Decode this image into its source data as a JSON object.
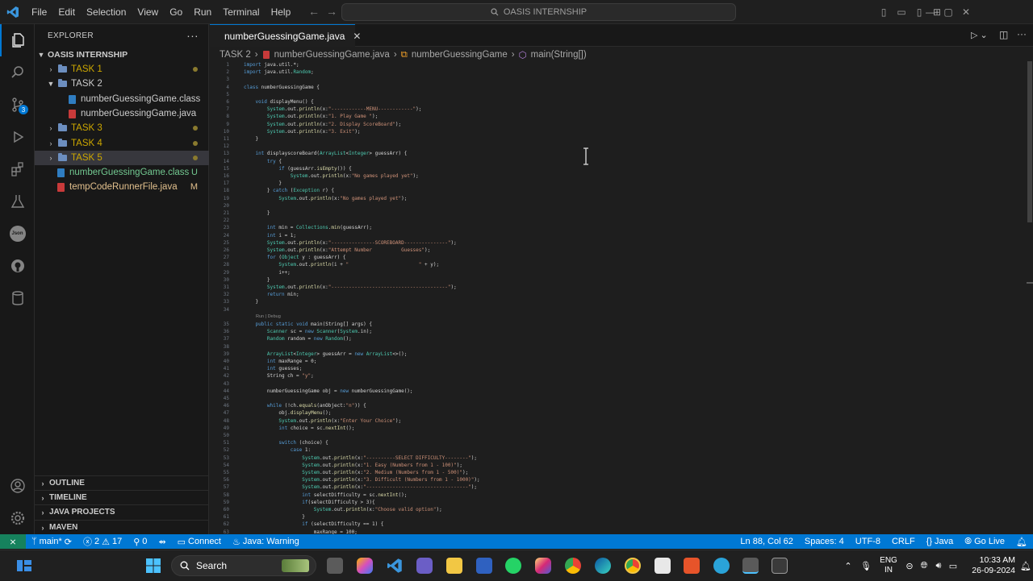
{
  "titlebar": {
    "menus": [
      "File",
      "Edit",
      "Selection",
      "View",
      "Go",
      "Run",
      "Terminal",
      "Help"
    ],
    "search_text": "OASIS INTERNSHIP"
  },
  "sidebar": {
    "header": "EXPLORER",
    "root": "OASIS INTERNSHIP",
    "items": [
      {
        "label": "TASK 1",
        "kind": "folder",
        "mark": "dot"
      },
      {
        "label": "TASK 2",
        "kind": "folder-open",
        "mark": ""
      },
      {
        "label": "numberGuessingGame.class",
        "kind": "class",
        "mark": ""
      },
      {
        "label": "numberGuessingGame.java",
        "kind": "java",
        "mark": ""
      },
      {
        "label": "TASK 3",
        "kind": "folder",
        "mark": "dot"
      },
      {
        "label": "TASK 4",
        "kind": "folder",
        "mark": "dot"
      },
      {
        "label": "TASK 5",
        "kind": "folder",
        "mark": "dot"
      },
      {
        "label": "numberGuessingGame.class",
        "kind": "class",
        "mark": "U"
      },
      {
        "label": "tempCodeRunnerFile.java",
        "kind": "java",
        "mark": "M"
      }
    ],
    "panels": [
      "OUTLINE",
      "TIMELINE",
      "JAVA PROJECTS",
      "MAVEN"
    ]
  },
  "editor": {
    "tab": "numberGuessingGame.java",
    "breadcrumb": [
      "TASK 2",
      "numberGuessingGame.java",
      "numberGuessingGame",
      "main(String[])"
    ],
    "codelens": "Run | Debug",
    "lines": [
      "import java.util.*;",
      "import java.util.Random;",
      "",
      "class numberGuessingGame {",
      "",
      "    void displayMenu() {",
      "        System.out.println(x:\"------------MENU------------\");",
      "        System.out.println(x:\"1. Play Game \");",
      "        System.out.println(x:\"2. Display ScoreBoard\");",
      "        System.out.println(x:\"3. Exit\");",
      "    }",
      "",
      "    int displayscoreBoard(ArrayList<Integer> guessArr) {",
      "        try {",
      "            if (guessArr.isEmpty()) {",
      "                System.out.println(x:\"No games played yet\");",
      "            }",
      "        } catch (Exception r) {",
      "            System.out.println(x:\"No games played yet\");",
      "",
      "        }",
      "",
      "        int min = Collections.min(guessArr);",
      "        int i = 1;",
      "        System.out.println(x:\"---------------SCOREBOARD---------------\");",
      "        System.out.println(x:\"Attempt Number          Guesses\");",
      "        for (Object y : guessArr) {",
      "            System.out.println(i + \"                        \" + y);",
      "            i++;",
      "        }",
      "        System.out.println(x:\"----------------------------------------\");",
      "        return min;",
      "    }",
      "",
      "    public static void main(String[] args) {",
      "        Scanner sc = new Scanner(System.in);",
      "        Random random = new Random();",
      "",
      "        ArrayList<Integer> guessArr = new ArrayList<>();",
      "        int maxRange = 0;",
      "        int guesses;",
      "        String ch = \"y\";",
      "",
      "        numberGuessingGame obj = new numberGuessingGame();",
      "",
      "        while (!ch.equals(anObject:\"n\")) {",
      "            obj.displayMenu();",
      "            System.out.println(x:\"Enter Your Choice\");",
      "            int choice = sc.nextInt();",
      "",
      "            switch (choice) {",
      "                case 1:",
      "                    System.out.println(x:\"----------SELECT DIFFICULTY--------\");",
      "                    System.out.println(x:\"1. Easy (Numbers from 1 - 100)\");",
      "                    System.out.println(x:\"2. Medium (Numbers from 1 - 500)\");",
      "                    System.out.println(x:\"3. Difficult (Numbers from 1 - 1000)\");",
      "                    System.out.println(x:\"-----------------------------------\");",
      "                    int selectDifficulty = sc.nextInt();",
      "                    if(selectDifficulty > 3){",
      "                        System.out.println(x:\"Choose valid option\");",
      "                    }",
      "                    if (selectDifficulty == 1) {",
      "                        maxRange = 100;"
    ]
  },
  "statusbar": {
    "branch": "main*",
    "errors": "2",
    "warnings": "17",
    "info": "0",
    "connect": "Connect",
    "java_status": "Java: Warning",
    "position": "Ln 88, Col 62",
    "spaces": "Spaces: 4",
    "encoding": "UTF-8",
    "eol": "CRLF",
    "language": "Java",
    "golive": "Go Live"
  },
  "taskbar": {
    "search": "Search",
    "lang_top": "ENG",
    "lang_bottom": "IN",
    "time": "10:33 AM",
    "date": "26-09-2024"
  },
  "colors": {
    "accent": "#0078d4",
    "keyword": "#569cd6",
    "string": "#ce9178",
    "type": "#4ec9b0",
    "method": "#dcdcaa",
    "folder_modified": "#cca700",
    "untracked": "#73c991",
    "modified": "#e2c08d"
  }
}
